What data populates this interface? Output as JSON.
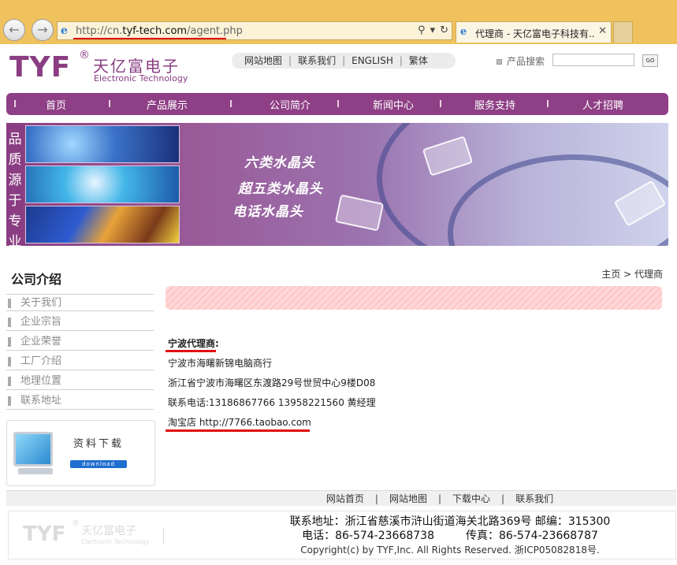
{
  "browser": {
    "url_prefix": "http://cn.",
    "url_domain": "tyf-tech.com",
    "url_path": "/agent.php",
    "tab_title": "代理商 - 天亿富电子科技有...",
    "icons": {
      "back": "back-arrow-icon",
      "forward": "forward-arrow-icon",
      "search": "search-icon",
      "dropdown": "chevron-down-icon",
      "refresh": "refresh-icon",
      "close": "close-icon",
      "site": "ie-page-icon"
    }
  },
  "header": {
    "logo_main": "TYF",
    "logo_reg": "®",
    "logo_cn": "天亿富电子",
    "logo_en": "Electronic Technology",
    "top_links": [
      "网站地图",
      "联系我们",
      "ENGLISH",
      "繁体"
    ],
    "search_label": "产品搜索",
    "search_value": "",
    "search_button": "GO"
  },
  "nav": {
    "items": [
      "首页",
      "产品展示",
      "公司简介",
      "新闻中心",
      "服务支持",
      "人才招聘"
    ]
  },
  "banner": {
    "vertical_text": [
      "品",
      "质",
      "源",
      "于",
      "专",
      "业"
    ],
    "lines": [
      "六类水晶头",
      "超五类水晶头",
      "电话水晶头"
    ]
  },
  "sidebar": {
    "title": "公司介绍",
    "items": [
      "关于我们",
      "企业宗旨",
      "企业荣誉",
      "工厂介绍",
      "地理位置",
      "联系地址"
    ],
    "download_title": "资料下载",
    "download_button": "download"
  },
  "main": {
    "breadcrumb": "主页 > 代理商",
    "agent_heading": "宁波代理商:",
    "lines": [
      "宁波市海曙新锦电脑商行",
      "浙江省宁波市海曙区东渡路29号世贸中心9楼D08",
      "联系电话:13186867766 13958221560 黄经理",
      "淘宝店 http://7766.taobao.com"
    ]
  },
  "footer": {
    "links": [
      "网站首页",
      "网站地图",
      "下载中心",
      "联系我们"
    ],
    "address": "联系地址：浙江省慈溪市浒山街道海关北路369号 邮编：315300",
    "phone": "电话：86-574-23668738",
    "fax": "传真：86-574-23668787",
    "copyright": "Copyright(c) by TYF,Inc. All Rights Reserved. 浙ICP05082818号.",
    "logo_main": "TYF",
    "logo_reg": "®",
    "logo_cn": "天亿富电子",
    "logo_en": "Electronic Technology"
  },
  "colors": {
    "brand_purple": "#8e3f85",
    "chrome_bar": "#f0c25e",
    "annotation_red": "#e01010",
    "pink_bar": "#ffd0d0"
  }
}
